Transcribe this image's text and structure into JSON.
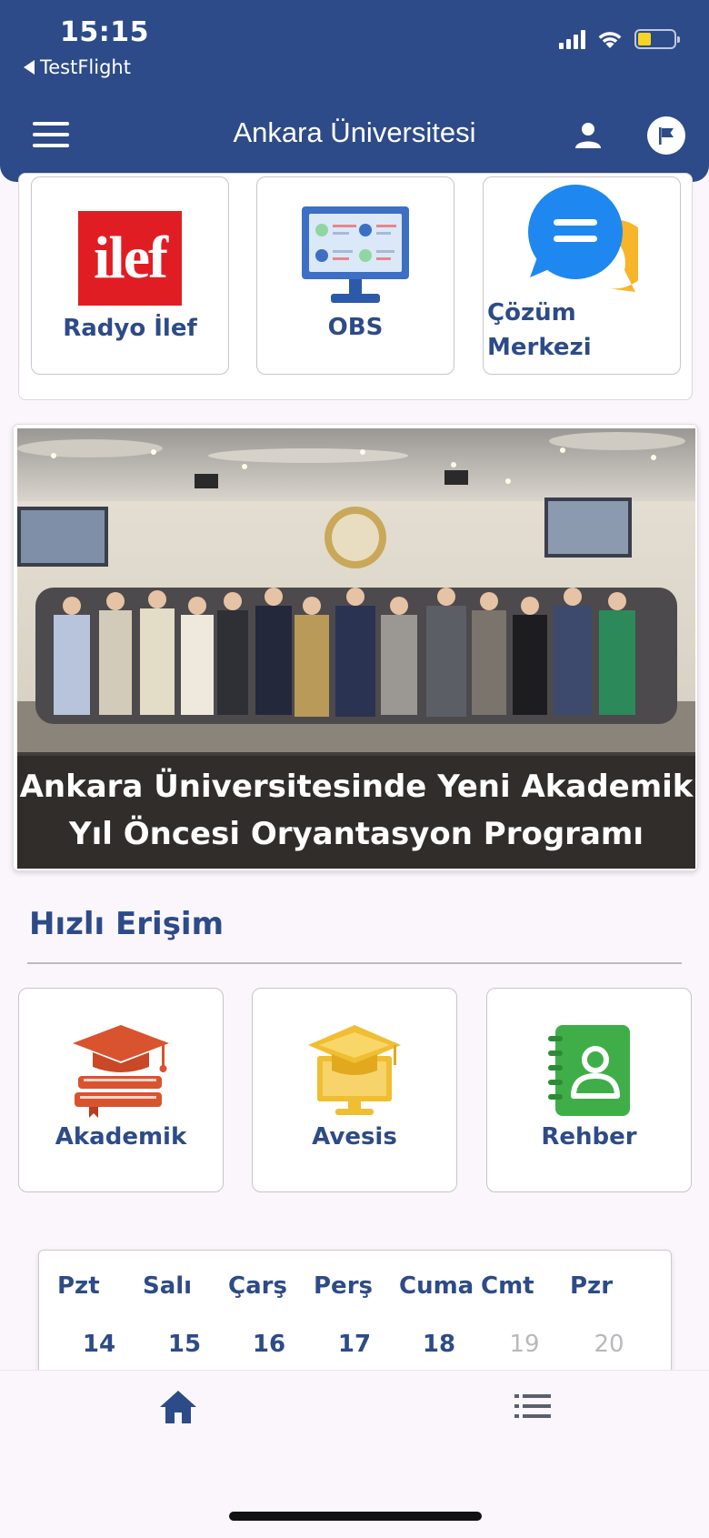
{
  "status_bar": {
    "time": "15:15",
    "back_app": "TestFlight"
  },
  "header": {
    "title": "Ankara Üniversitesi",
    "icons": [
      "menu-icon",
      "user-icon",
      "flag-icon"
    ]
  },
  "top_shortcuts": [
    {
      "label": "Radyo İlef",
      "logo_text": "ilef",
      "icon": "ilef-logo"
    },
    {
      "label": "OBS",
      "icon": "monitor-icon"
    },
    {
      "label": "Çözüm Merkezi",
      "icon": "chat-bubbles-icon"
    }
  ],
  "news": {
    "headline_line1": "Ankara Üniversitesinde Yeni Akademik",
    "headline_line2": "Yıl Öncesi Oryantasyon Programı"
  },
  "quick_access": {
    "title": "Hızlı Erişim",
    "items": [
      {
        "label": "Akademik",
        "icon": "graduation-cap-books-icon",
        "color": "#d9532f"
      },
      {
        "label": "Avesis",
        "icon": "graduation-cap-monitor-icon",
        "color": "#f0be32"
      },
      {
        "label": "Rehber",
        "icon": "contact-book-icon",
        "color": "#3fae49"
      }
    ]
  },
  "calendar": {
    "day_names": [
      "Pzt",
      "Salı",
      "Çarş",
      "Perş",
      "Cuma",
      "Cmt",
      "Pzr"
    ],
    "day_numbers": [
      "14",
      "15",
      "16",
      "17",
      "18",
      "19",
      "20"
    ]
  },
  "bottom_nav": {
    "tabs": [
      "home-icon",
      "list-icon"
    ]
  },
  "colors": {
    "primary": "#2d4b88",
    "background": "#fbf6fb"
  }
}
